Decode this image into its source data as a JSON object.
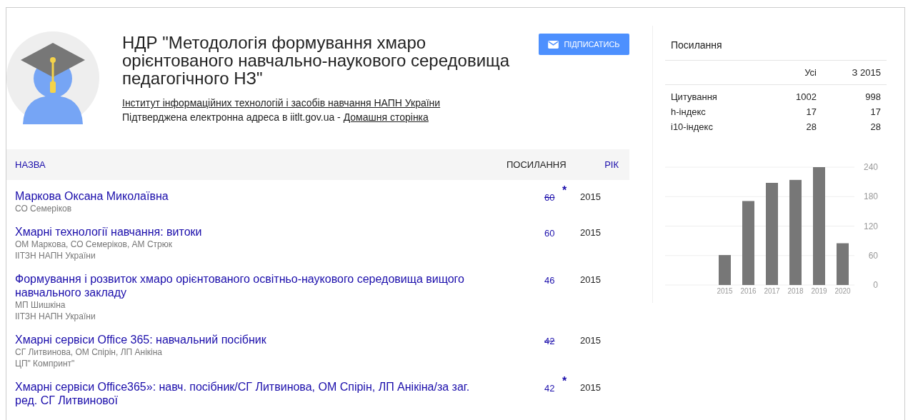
{
  "profile": {
    "title": "НДР \"Методологія формування хмаро орієнтованого навчально-наукового середовища педагогічного НЗ\"",
    "affiliation": "Інститут інформаційних технологій і засобів навчання НАПН України",
    "email_note": "Підтверджена електронна адреса в iitlt.gov.ua - ",
    "homepage_link": "Домашня сторінка",
    "follow_button": "ПІДПИСАТИСЬ"
  },
  "table": {
    "columns": [
      {
        "label": "НАЗВА",
        "kind": "link"
      },
      {
        "label": "ПОСИЛАННЯ",
        "kind": "plain"
      },
      {
        "label": "РІК",
        "kind": "link"
      }
    ],
    "rows": [
      {
        "title": "Маркова Оксана Миколаївна",
        "lines": [
          "СО Семеріков"
        ],
        "citations": "60",
        "struck": true,
        "star": "*",
        "year": "2015"
      },
      {
        "title": "Хмарні технології навчання: витоки",
        "lines": [
          "ОМ Маркова, СО Семеріков, АМ Стрюк",
          "ІІТЗН НАПН України"
        ],
        "citations": "60",
        "struck": false,
        "year": "2015"
      },
      {
        "title": "Формування і розвиток хмаро орієнтованого освітньо-наукового середовища вищого навчального закладу",
        "lines": [
          "МП Шишкіна",
          "ІІТЗН НАПН України"
        ],
        "citations": "46",
        "struck": false,
        "year": "2015"
      },
      {
        "title": "Хмарні сервіси Office 365: навчальний посібник",
        "lines": [
          "СГ Литвинова, ОМ Спірін, ЛП Анікіна",
          "ЦП\" Компринт\""
        ],
        "citations": "42",
        "struck": true,
        "year": "2015"
      },
      {
        "title": "Хмарні сервіси Office365»: навч. посібник/СГ Литвинова, ОМ Спірін, ЛП Анікіна/за заг. ред. СГ Литвинової",
        "lines": [],
        "citations": "42",
        "struck": false,
        "star": "*",
        "year": "2015"
      }
    ]
  },
  "citations_panel": {
    "title": "Посилання",
    "columns": [
      "Усі",
      "З 2015"
    ],
    "rows": [
      {
        "label": "Цитування",
        "all": "1002",
        "since": "998"
      },
      {
        "label": "h-індекс",
        "all": "17",
        "since": "17"
      },
      {
        "label": "i10-індекс",
        "all": "28",
        "since": "28"
      }
    ],
    "chart_data": {
      "type": "bar",
      "categories": [
        "2015",
        "2016",
        "2017",
        "2018",
        "2019",
        "2020"
      ],
      "series": [
        {
          "color": "#777777",
          "values": [
            61,
            171,
            208,
            214,
            240,
            85
          ]
        }
      ],
      "ylim": [
        0,
        240
      ],
      "yticks": [
        0,
        60,
        120,
        180,
        240
      ],
      "grid": true
    }
  }
}
